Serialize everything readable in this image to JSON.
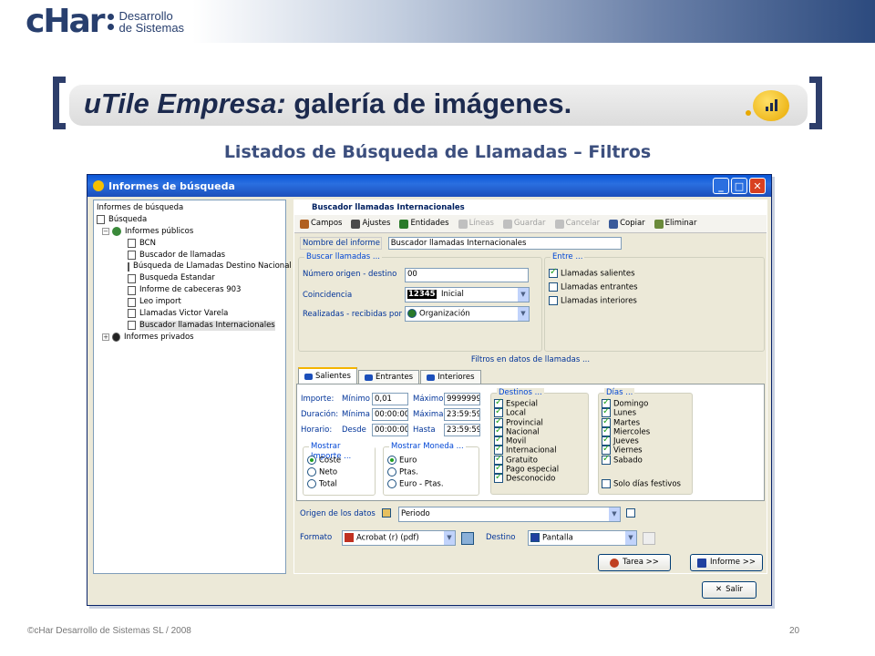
{
  "brand": {
    "wordmark": "cHar",
    "sub1": "Desarrollo",
    "sub2": "de Sistemas"
  },
  "slide": {
    "title_italic": "uTile Empresa:",
    "title_rest": " galería de imágenes.",
    "subtitle": "Listados de Búsqueda de Llamadas – Filtros"
  },
  "footer": {
    "left": "©cHar Desarrollo de Sistemas SL / 2008",
    "page": "20"
  },
  "window": {
    "title": "Informes de búsqueda",
    "btn_min": "_",
    "btn_max": "□",
    "btn_close": "✕"
  },
  "tree": {
    "items": [
      "Informes de búsqueda",
      "Búsqueda",
      "Informes públicos",
      "BCN",
      "Buscador de llamadas",
      "Búsqueda de Llamadas Destino Nacional",
      "Busqueda Estandar",
      "Informe de cabeceras 903",
      "Leo import",
      "Llamadas Victor Varela",
      "Buscador llamadas Internacionales",
      "Informes privados"
    ]
  },
  "panel": {
    "header": "Buscador llamadas Internacionales",
    "toolbar": {
      "campos": "Campos",
      "ajustes": "Ajustes",
      "entidades": "Entidades",
      "lineas": "Líneas",
      "guardar": "Guardar",
      "cancelar": "Cancelar",
      "copiar": "Copiar",
      "eliminar": "Eliminar"
    },
    "nombre_label": "Nombre del informe",
    "nombre_value": "Buscador llamadas Internacionales",
    "buscar_legend": "Buscar llamadas ...",
    "numero_label": "Número origen - destino",
    "numero_value": "00",
    "coinc_label": "Coincidencia",
    "coinc_num": "12345",
    "coinc_value": "Inicial",
    "realiz_label": "Realizadas - recibidas por",
    "realiz_value": "Organización",
    "entre_legend": "Entre ...",
    "entre": [
      "Llamadas salientes",
      "Llamadas entrantes",
      "Llamadas interiores"
    ],
    "filtros_title": "Filtros en datos de llamadas ...",
    "tabs": [
      "Salientes",
      "Entrantes",
      "Interiores"
    ],
    "importe_label": "Importe:",
    "duracion_label": "Duración:",
    "horario_label": "Horario:",
    "minimo": "Mínimo",
    "maximo": "Máximo",
    "minima": "Mínima",
    "maxima": "Máxima",
    "desde": "Desde",
    "hasta": "Hasta",
    "imp_min": "0,01",
    "imp_max": "9999999,",
    "dur_min": "00:00:00",
    "dur_max": "23:59:59",
    "hor_min": "00:00:00",
    "hor_max": "23:59:59",
    "mimporte_legend": "Mostrar Importe ...",
    "mimporte": [
      "Coste",
      "Neto",
      "Total"
    ],
    "mmoneda_legend": "Mostrar Moneda ...",
    "mmoneda": [
      "Euro",
      "Ptas.",
      "Euro - Ptas."
    ],
    "destinos_legend": "Destinos ...",
    "destinos": [
      "Especial",
      "Local",
      "Provincial",
      "Nacional",
      "Movil",
      "Internacional",
      "Gratuito",
      "Pago especial",
      "Desconocido"
    ],
    "dias_legend": "Días ...",
    "dias": [
      "Domingo",
      "Lunes",
      "Martes",
      "Miercoles",
      "Jueves",
      "Viernes",
      "Sabado"
    ],
    "festivos": "Solo días festivos",
    "origen_label": "Origen de los datos",
    "origen_value": "Periodo",
    "formato_label": "Formato",
    "formato_value": "Acrobat (r) (pdf)",
    "destino_label": "Destino",
    "destino_value": "Pantalla",
    "tarea_btn": "Tarea >>",
    "informe_btn": "Informe >>",
    "salir_btn": "Salir"
  }
}
